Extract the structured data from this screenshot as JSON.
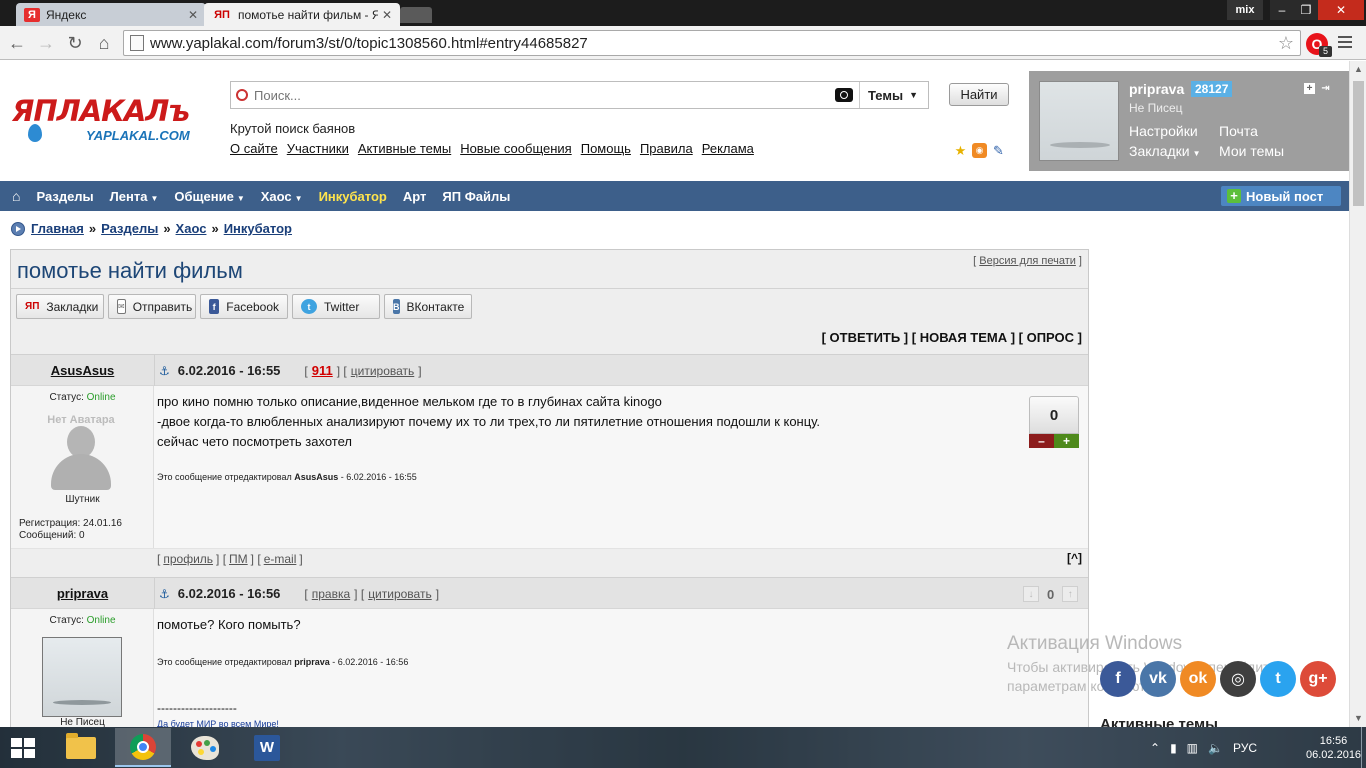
{
  "browser": {
    "tabs": [
      {
        "title": "Яндекс",
        "favicon": "Я"
      },
      {
        "title": "помотье найти фильм - Я",
        "favicon": "ЯП"
      }
    ],
    "profile_label": "mix",
    "url": "www.yaplakal.com/forum3/st/0/topic1308560.html#entry44685827",
    "extension_badge": "5"
  },
  "site": {
    "logo_main": "ЯПЛАКАЛъ",
    "logo_sub": "YAPLAKAL.COM",
    "search_placeholder": "Поиск...",
    "search_scope": "Темы",
    "search_button": "Найти",
    "tagline": "Крутой поиск баянов",
    "top_links": [
      "О сайте",
      "Участники",
      "Активные темы",
      "Новые сообщения",
      "Помощь",
      "Правила",
      "Реклама"
    ],
    "user": {
      "name": "priprava",
      "rep": "28127",
      "rank": "Не Писец",
      "links": [
        "Настройки",
        "Почта",
        "Закладки",
        "Мои темы"
      ]
    },
    "nav": [
      "Разделы",
      "Лента",
      "Общение",
      "Хаос",
      "Инкубатор",
      "Арт",
      "ЯП Файлы"
    ],
    "new_post": "Новый пост",
    "breadcrumbs": [
      "Главная",
      "Разделы",
      "Хаос",
      "Инкубатор"
    ]
  },
  "topic": {
    "title": "помотье найти фильм",
    "print_version": "Версия для печати",
    "share": [
      "Закладки",
      "Отправить",
      "Facebook",
      "Twitter",
      "ВКонтакте"
    ],
    "actions": "[ ОТВЕТИТЬ ] [ НОВАЯ ТЕМА ] [ ОПРОС ]",
    "posts": [
      {
        "author": "AsusAsus",
        "date": "6.02.2016 - 16:55",
        "num": "911",
        "quote": "цитировать",
        "status_label": "Статус:",
        "status": "Online",
        "avatar_label": "Нет Аватара",
        "rank": "Шутник",
        "reg": "Регистрация:  24.01.16",
        "msgs": "Сообщений:  0",
        "lines": [
          "про кино помню только описание,виденное мельком где то в глубинах сайта kinogo",
          "-двое когда-то влюбленных анализируют почему их то ли трех,то ли пятилетние отношения подошли к концу.",
          "сейчас чето посмотреть захотел"
        ],
        "edited_prefix": "Это сообщение отредактировал",
        "edited_user": "AsusAsus",
        "edited_date": " - 6.02.2016 - 16:55",
        "score": "0",
        "foot_links": [
          "профиль",
          "ПМ",
          "e-mail"
        ],
        "up": "[^]"
      },
      {
        "author": "priprava",
        "date": "6.02.2016 - 16:56",
        "edit": "правка",
        "quote": "цитировать",
        "status_label": "Статус:",
        "status": "Online",
        "rank": "Не Писец",
        "lines": [
          "помотье? Кого помыть?"
        ],
        "edited_prefix": "Это сообщение отредактировал",
        "edited_user": "priprava",
        "edited_date": " - 6.02.2016 - 16:56",
        "sig_line": "--------------------",
        "signature": "Да будет МИР во всем Мире!",
        "score": "0"
      }
    ]
  },
  "overlay": {
    "activation_title": "Активация Windows",
    "activation_text_1": "Чтобы активировать Windows, перейдите к",
    "activation_text_2": "параметрам компьютера.",
    "active_topics": "Активные темы"
  },
  "taskbar": {
    "lang": "РУС",
    "time": "16:56",
    "date": "06.02.2016"
  }
}
